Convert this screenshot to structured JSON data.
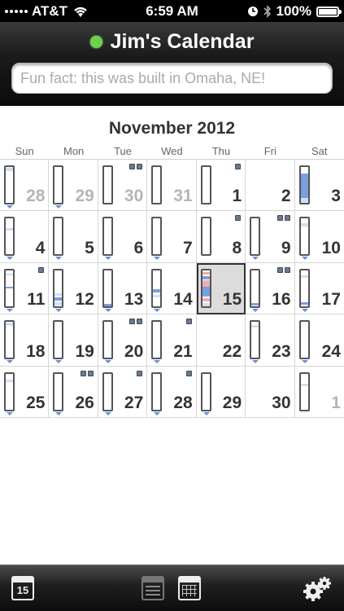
{
  "status_bar": {
    "carrier": "AT&T",
    "time": "6:59 AM",
    "battery_percent": "100%",
    "battery_level": 1.0,
    "icons": [
      "signal-dots-icon",
      "wifi-icon",
      "clock-icon",
      "bluetooth-icon",
      "battery-icon"
    ]
  },
  "header": {
    "title": "Jim's Calendar",
    "status_color": "#6bd24a",
    "search_placeholder": "Fun fact: this was built in Omaha, NE!"
  },
  "calendar": {
    "month_label": "November 2012",
    "weekdays": [
      "Sun",
      "Mon",
      "Tue",
      "Wed",
      "Thu",
      "Fri",
      "Sat"
    ],
    "today": 15,
    "days": [
      {
        "label": "28",
        "other_month": true
      },
      {
        "label": "29",
        "other_month": true
      },
      {
        "label": "30",
        "other_month": true
      },
      {
        "label": "31",
        "other_month": true
      },
      {
        "label": "1"
      },
      {
        "label": "2"
      },
      {
        "label": "3"
      },
      {
        "label": "4"
      },
      {
        "label": "5"
      },
      {
        "label": "6"
      },
      {
        "label": "7"
      },
      {
        "label": "8"
      },
      {
        "label": "9"
      },
      {
        "label": "10"
      },
      {
        "label": "11"
      },
      {
        "label": "12"
      },
      {
        "label": "13"
      },
      {
        "label": "14"
      },
      {
        "label": "15",
        "today": true
      },
      {
        "label": "16"
      },
      {
        "label": "17"
      },
      {
        "label": "18"
      },
      {
        "label": "19"
      },
      {
        "label": "20"
      },
      {
        "label": "21"
      },
      {
        "label": "22"
      },
      {
        "label": "23"
      },
      {
        "label": "24"
      },
      {
        "label": "25"
      },
      {
        "label": "26"
      },
      {
        "label": "27"
      },
      {
        "label": "28"
      },
      {
        "label": "29"
      },
      {
        "label": "30"
      },
      {
        "label": "1",
        "other_month": true
      }
    ]
  },
  "toolbar": {
    "today_button_label": "15",
    "icons": [
      "calendar-today-icon",
      "list-view-icon",
      "month-view-icon",
      "settings-gear-icon"
    ]
  },
  "colors": {
    "event_blue": "#7a9fe0",
    "event_light_blue": "#cfe0f5",
    "event_red": "#e7b0b0",
    "marker_dark": "#6a7a8c"
  }
}
